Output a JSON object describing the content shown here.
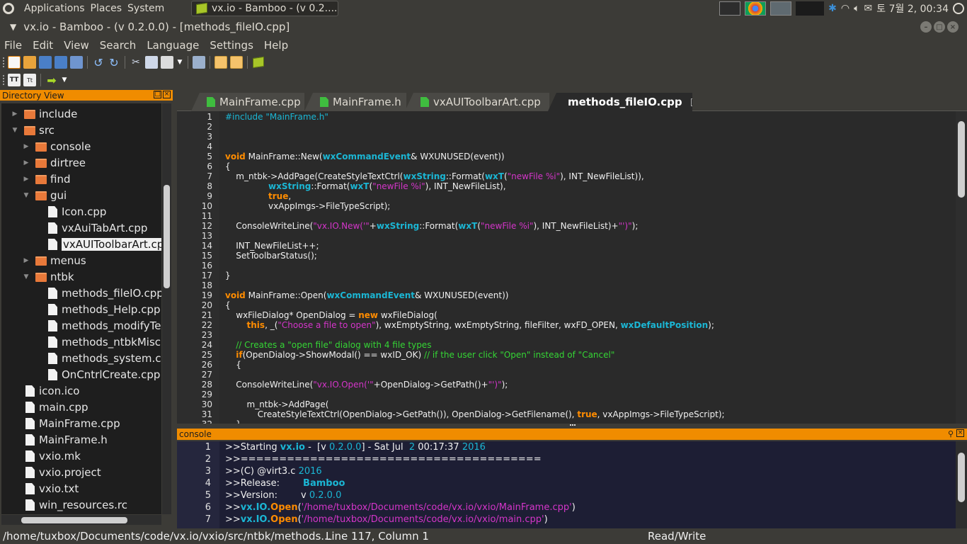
{
  "top_panel": {
    "menus": [
      "Applications",
      "Places",
      "System"
    ],
    "task_title": "vx.io - Bamboo - (v 0.2....",
    "clock": "토  7월  2, 00:34"
  },
  "window": {
    "title": "vx.io - Bamboo - (v 0.2.0.0) - [methods_fileIO.cpp]"
  },
  "menubar": [
    "File",
    "Edit",
    "View",
    "Search",
    "Language",
    "Settings",
    "Help"
  ],
  "directory_view": {
    "title": "Directory View",
    "items": [
      {
        "label": "include",
        "type": "folder",
        "depth": 1,
        "expanded": false
      },
      {
        "label": "src",
        "type": "folder",
        "depth": 1,
        "expanded": true
      },
      {
        "label": "console",
        "type": "folder",
        "depth": 2,
        "expanded": false
      },
      {
        "label": "dirtree",
        "type": "folder",
        "depth": 2,
        "expanded": false
      },
      {
        "label": "find",
        "type": "folder",
        "depth": 2,
        "expanded": false
      },
      {
        "label": "gui",
        "type": "folder",
        "depth": 2,
        "expanded": true
      },
      {
        "label": "Icon.cpp",
        "type": "file",
        "depth": 3
      },
      {
        "label": "vxAuiTabArt.cpp",
        "type": "file",
        "depth": 3
      },
      {
        "label": "vxAUIToolbarArt.cp",
        "type": "file",
        "depth": 3,
        "selected": true
      },
      {
        "label": "menus",
        "type": "folder",
        "depth": 2,
        "expanded": false
      },
      {
        "label": "ntbk",
        "type": "folder",
        "depth": 2,
        "expanded": true
      },
      {
        "label": "methods_fileIO.cpp",
        "type": "file",
        "depth": 3
      },
      {
        "label": "methods_Help.cpp",
        "type": "file",
        "depth": 3
      },
      {
        "label": "methods_modifyTex",
        "type": "file",
        "depth": 3
      },
      {
        "label": "methods_ntbkMisc.",
        "type": "file",
        "depth": 3
      },
      {
        "label": "methods_system.cp",
        "type": "file",
        "depth": 3
      },
      {
        "label": "OnCntrlCreate.cpp",
        "type": "file",
        "depth": 3
      },
      {
        "label": "icon.ico",
        "type": "file",
        "depth": 1
      },
      {
        "label": "main.cpp",
        "type": "file",
        "depth": 1
      },
      {
        "label": "MainFrame.cpp",
        "type": "file",
        "depth": 1
      },
      {
        "label": "MainFrame.h",
        "type": "file",
        "depth": 1
      },
      {
        "label": "vxio.mk",
        "type": "file",
        "depth": 1
      },
      {
        "label": "vxio.project",
        "type": "file",
        "depth": 1
      },
      {
        "label": "vxio.txt",
        "type": "file",
        "depth": 1
      },
      {
        "label": "win_resources.rc",
        "type": "file",
        "depth": 1
      }
    ]
  },
  "tabs": [
    {
      "label": "MainFrame.cpp",
      "active": false
    },
    {
      "label": "MainFrame.h",
      "active": false
    },
    {
      "label": "vxAUIToolbarArt.cpp",
      "active": false
    },
    {
      "label": "methods_fileIO.cpp",
      "active": true
    }
  ],
  "editor": {
    "lines": [
      [
        [
          "pp",
          "#include \"MainFrame.h\""
        ]
      ],
      [],
      [],
      [],
      [
        [
          "kw",
          "void"
        ],
        [
          "",
          " MainFrame::New("
        ],
        [
          "ty",
          "wxCommandEvent"
        ],
        [
          "",
          "& WXUNUSED(event))"
        ]
      ],
      [
        [
          "",
          "{"
        ]
      ],
      [
        [
          "",
          "    m_ntbk->AddPage(CreateStyleTextCtrl("
        ],
        [
          "ty",
          "wxString"
        ],
        [
          "",
          "::Format("
        ],
        [
          "ty",
          "wxT"
        ],
        [
          "",
          "("
        ],
        [
          "st",
          "\"newFile %i\""
        ],
        [
          "",
          "), INT_NewFileList)),"
        ]
      ],
      [
        [
          "",
          "                "
        ],
        [
          "ty",
          "wxString"
        ],
        [
          "",
          "::Format("
        ],
        [
          "ty",
          "wxT"
        ],
        [
          "",
          "("
        ],
        [
          "st",
          "\"newFile %i\""
        ],
        [
          "",
          "), INT_NewFileList),"
        ]
      ],
      [
        [
          "",
          "                "
        ],
        [
          "kw",
          "true"
        ],
        [
          "",
          ","
        ]
      ],
      [
        [
          "",
          "                vxAppImgs->FileTypeScript);"
        ]
      ],
      [],
      [
        [
          "",
          "    ConsoleWriteLine("
        ],
        [
          "st",
          "\"vx.IO.New('\""
        ],
        [
          "",
          "+"
        ],
        [
          "ty",
          "wxString"
        ],
        [
          "",
          "::Format("
        ],
        [
          "ty",
          "wxT"
        ],
        [
          "",
          "("
        ],
        [
          "st",
          "\"newFile %i\""
        ],
        [
          "",
          "), INT_NewFileList)+"
        ],
        [
          "st",
          "\"')\""
        ],
        [
          "",
          ");"
        ]
      ],
      [],
      [
        [
          "",
          "    INT_NewFileList++;"
        ]
      ],
      [
        [
          "",
          "    SetToolbarStatus();"
        ]
      ],
      [],
      [
        [
          "",
          "}"
        ]
      ],
      [],
      [
        [
          "kw",
          "void"
        ],
        [
          "",
          " MainFrame::Open("
        ],
        [
          "ty",
          "wxCommandEvent"
        ],
        [
          "",
          "& WXUNUSED(event))"
        ]
      ],
      [
        [
          "",
          "{"
        ]
      ],
      [
        [
          "",
          "    wxFileDialog* OpenDialog = "
        ],
        [
          "kw",
          "new"
        ],
        [
          "",
          " wxFileDialog("
        ]
      ],
      [
        [
          "",
          "        "
        ],
        [
          "kw",
          "this"
        ],
        [
          "",
          ", _("
        ],
        [
          "st",
          "\"Choose a file to open\""
        ],
        [
          "",
          "), wxEmptyString, wxEmptyString, fileFilter, wxFD_OPEN, "
        ],
        [
          "ty",
          "wxDefaultPosition"
        ],
        [
          "",
          ");"
        ]
      ],
      [],
      [
        [
          "cm",
          "    // Creates a \"open file\" dialog with 4 file types"
        ]
      ],
      [
        [
          "",
          "    "
        ],
        [
          "kw",
          "if"
        ],
        [
          "",
          "(OpenDialog->ShowModal() == wxID_OK) "
        ],
        [
          "cm",
          "// if the user click \"Open\" instead of \"Cancel\""
        ]
      ],
      [
        [
          "",
          "    {"
        ]
      ],
      [],
      [
        [
          "",
          "    ConsoleWriteLine("
        ],
        [
          "st",
          "\"vx.IO.Open('\""
        ],
        [
          "",
          "+OpenDialog->GetPath()+"
        ],
        [
          "st",
          "\"')\""
        ],
        [
          "",
          ");"
        ]
      ],
      [],
      [
        [
          "",
          "        m_ntbk->AddPage("
        ]
      ],
      [
        [
          "",
          "            CreateStyleTextCtrl(OpenDialog->GetPath()), OpenDialog->GetFilename(), "
        ],
        [
          "kw",
          "true"
        ],
        [
          "",
          ", vxAppImgs->FileTypeScript);"
        ]
      ],
      [
        [
          "",
          "    }"
        ]
      ]
    ]
  },
  "console": {
    "title": "console",
    "lines": [
      [
        [
          "",
          ">>Starting "
        ],
        [
          "cy",
          "vx.io"
        ],
        [
          "",
          " -  [v "
        ],
        [
          "cyl",
          "0.2.0.0"
        ],
        [
          "",
          "] - Sat Jul  "
        ],
        [
          "cyl",
          "2"
        ],
        [
          "",
          " 00:17:37 "
        ],
        [
          "cyl",
          "2016"
        ]
      ],
      [
        [
          "",
          ">>======================================="
        ]
      ],
      [
        [
          "",
          ">>(C) @virt3.c "
        ],
        [
          "cyl",
          "2016"
        ]
      ],
      [
        [
          "",
          ">>Release:        "
        ],
        [
          "cy",
          "Bamboo"
        ]
      ],
      [
        [
          "",
          ">>Version:        v "
        ],
        [
          "cyl",
          "0.2.0.0"
        ]
      ],
      [
        [
          "",
          ">>"
        ],
        [
          "cy",
          "vx.IO."
        ],
        [
          "co",
          "Open"
        ],
        [
          "",
          "("
        ],
        [
          "cm2",
          "'/home/tuxbox/Documents/code/vx.io/vxio/MainFrame.cpp'"
        ],
        [
          "",
          ")"
        ]
      ],
      [
        [
          "",
          ">>"
        ],
        [
          "cy",
          "vx.IO."
        ],
        [
          "co",
          "Open"
        ],
        [
          "",
          "("
        ],
        [
          "cm2",
          "'/home/tuxbox/Documents/code/vx.io/vxio/main.cpp'"
        ],
        [
          "",
          ")"
        ]
      ]
    ]
  },
  "statusbar": {
    "path": "/home/tuxbox/Documents/code/vx.io/vxio/src/ntbk/methods...",
    "position": "Line 117, Column 1",
    "mode": "Read/Write"
  },
  "colors": {
    "panel_header": "#f08c00",
    "keyword": "#ff8c00",
    "type": "#1bb6d4",
    "string": "#d435c9",
    "comment": "#35d535"
  }
}
